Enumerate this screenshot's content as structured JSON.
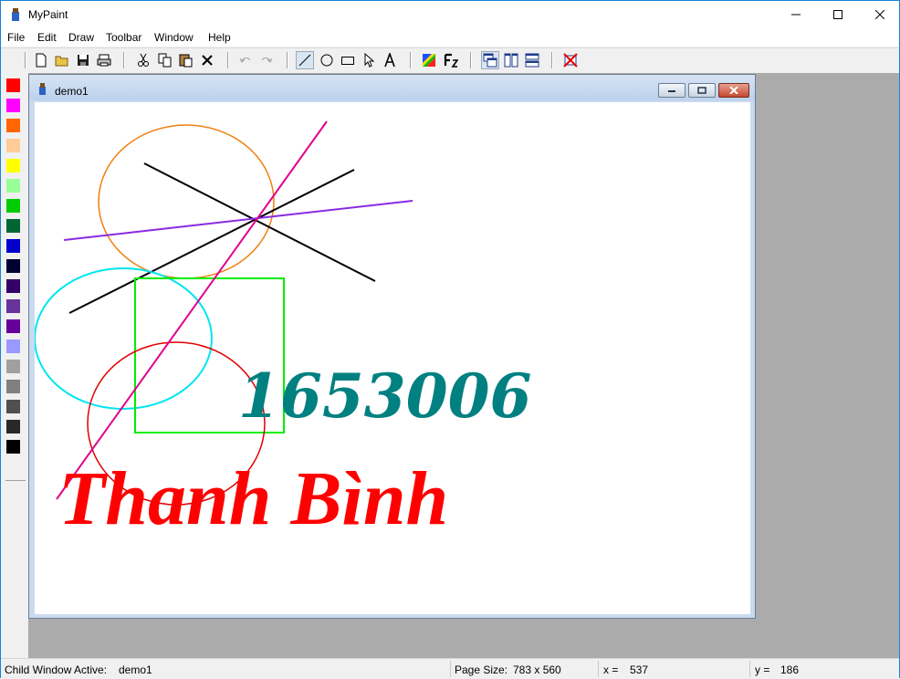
{
  "app": {
    "title": "MyPaint"
  },
  "menu": [
    "File",
    "Edit",
    "Draw",
    "Toolbar",
    "Window",
    "Help"
  ],
  "toolbar_icons": [
    "new-file-icon",
    "open-folder-icon",
    "save-icon",
    "print-icon",
    "cut-icon",
    "copy-icon",
    "paste-icon",
    "delete-icon",
    "undo-icon",
    "redo-icon",
    "line-tool-icon",
    "ellipse-tool-icon",
    "rectangle-tool-icon",
    "select-tool-icon",
    "text-tool-icon",
    "color-picker-icon",
    "font-icon",
    "cascade-windows-icon",
    "tile-vertical-icon",
    "tile-horizontal-icon",
    "close-all-windows-icon"
  ],
  "palette": [
    "#ff0000",
    "#ff00ff",
    "#ff6600",
    "#ffcc99",
    "#ffff00",
    "#99ff99",
    "#00cc00",
    "#006633",
    "#0000cc",
    "#000033",
    "#330066",
    "#663399",
    "#660099",
    "#9999ff",
    "#a0a0a0",
    "#808080",
    "#505050",
    "#282828",
    "#000000"
  ],
  "child_window": {
    "title": "demo1"
  },
  "canvas_text": {
    "number": "1653006",
    "name": "Thanh Bình"
  },
  "status": {
    "active_label": "Child Window Active:",
    "active_value": "demo1",
    "page_label": "Page Size:",
    "page_value": "783 x 560",
    "x_label": "x =",
    "x_value": "537",
    "y_label": "y =",
    "y_value": "186"
  }
}
